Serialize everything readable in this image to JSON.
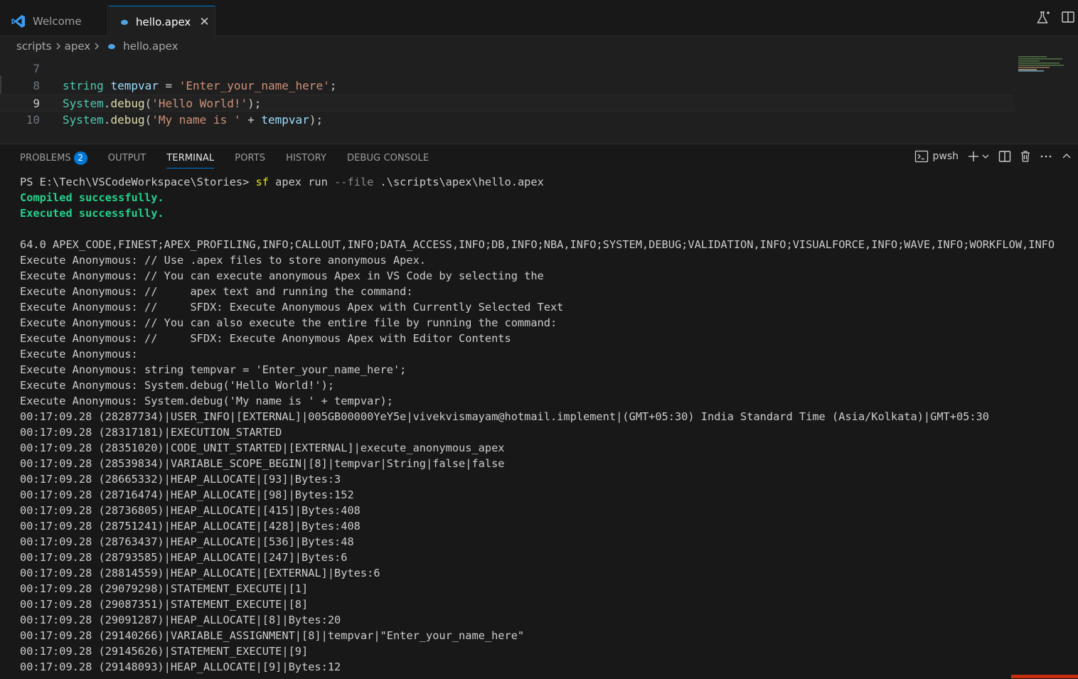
{
  "tabs": {
    "welcome": "Welcome",
    "active_file": "hello.apex",
    "close_glyph": "✕"
  },
  "breadcrumb": [
    "scripts",
    "apex",
    "hello.apex"
  ],
  "editor": {
    "lines": [
      {
        "num": "7",
        "tokens": []
      },
      {
        "num": "8",
        "tokens": [
          [
            "kw",
            "string"
          ],
          [
            "op",
            " "
          ],
          [
            "var",
            "tempvar"
          ],
          [
            "op",
            " = "
          ],
          [
            "str",
            "'Enter_your_name_here'"
          ],
          [
            "op",
            ";"
          ]
        ]
      },
      {
        "num": "9",
        "tokens": [
          [
            "kw",
            "System"
          ],
          [
            "op",
            "."
          ],
          [
            "fn",
            "debug"
          ],
          [
            "op",
            "("
          ],
          [
            "str",
            "'Hello World!'"
          ],
          [
            "op",
            ");"
          ]
        ]
      },
      {
        "num": "10",
        "tokens": [
          [
            "kw",
            "System"
          ],
          [
            "op",
            "."
          ],
          [
            "fn",
            "debug"
          ],
          [
            "op",
            "("
          ],
          [
            "str",
            "'My name is '"
          ],
          [
            "op",
            " + "
          ],
          [
            "var",
            "tempvar"
          ],
          [
            "op",
            ");"
          ]
        ]
      }
    ],
    "current_line": "9"
  },
  "panel": {
    "tabs": [
      "PROBLEMS",
      "OUTPUT",
      "TERMINAL",
      "PORTS",
      "HISTORY",
      "DEBUG CONSOLE"
    ],
    "active_tab": "TERMINAL",
    "problems_count": "2",
    "shell_name": "pwsh"
  },
  "terminal": {
    "prompt": "PS E:\\Tech\\VSCodeWorkspace\\Stories> ",
    "cmd_sf": "sf",
    "cmd_rest1": " apex run ",
    "cmd_flag": "--file",
    "cmd_rest2": " .\\scripts\\apex\\hello.apex",
    "compiled": "Compiled successfully.",
    "executed": "Executed successfully.",
    "log_lines": [
      "",
      "64.0 APEX_CODE,FINEST;APEX_PROFILING,INFO;CALLOUT,INFO;DATA_ACCESS,INFO;DB,INFO;NBA,INFO;SYSTEM,DEBUG;VALIDATION,INFO;VISUALFORCE,INFO;WAVE,INFO;WORKFLOW,INFO",
      "Execute Anonymous: // Use .apex files to store anonymous Apex.",
      "Execute Anonymous: // You can execute anonymous Apex in VS Code by selecting the",
      "Execute Anonymous: //     apex text and running the command:",
      "Execute Anonymous: //     SFDX: Execute Anonymous Apex with Currently Selected Text",
      "Execute Anonymous: // You can also execute the entire file by running the command:",
      "Execute Anonymous: //     SFDX: Execute Anonymous Apex with Editor Contents",
      "Execute Anonymous:",
      "Execute Anonymous: string tempvar = 'Enter_your_name_here';",
      "Execute Anonymous: System.debug('Hello World!');",
      "Execute Anonymous: System.debug('My name is ' + tempvar);",
      "00:17:09.28 (28287734)|USER_INFO|[EXTERNAL]|005GB00000YeY5e|vivekvismayam@hotmail.implement|(GMT+05:30) India Standard Time (Asia/Kolkata)|GMT+05:30",
      "00:17:09.28 (28317181)|EXECUTION_STARTED",
      "00:17:09.28 (28351020)|CODE_UNIT_STARTED|[EXTERNAL]|execute_anonymous_apex",
      "00:17:09.28 (28539834)|VARIABLE_SCOPE_BEGIN|[8]|tempvar|String|false|false",
      "00:17:09.28 (28665332)|HEAP_ALLOCATE|[93]|Bytes:3",
      "00:17:09.28 (28716474)|HEAP_ALLOCATE|[98]|Bytes:152",
      "00:17:09.28 (28736805)|HEAP_ALLOCATE|[415]|Bytes:408",
      "00:17:09.28 (28751241)|HEAP_ALLOCATE|[428]|Bytes:408",
      "00:17:09.28 (28763437)|HEAP_ALLOCATE|[536]|Bytes:48",
      "00:17:09.28 (28793585)|HEAP_ALLOCATE|[247]|Bytes:6",
      "00:17:09.28 (28814559)|HEAP_ALLOCATE|[EXTERNAL]|Bytes:6",
      "00:17:09.28 (29079298)|STATEMENT_EXECUTE|[1]",
      "00:17:09.28 (29087351)|STATEMENT_EXECUTE|[8]",
      "00:17:09.28 (29091287)|HEAP_ALLOCATE|[8]|Bytes:20",
      "00:17:09.28 (29140266)|VARIABLE_ASSIGNMENT|[8]|tempvar|\"Enter_your_name_here\"",
      "00:17:09.28 (29145626)|STATEMENT_EXECUTE|[9]",
      "00:17:09.28 (29148093)|HEAP_ALLOCATE|[9]|Bytes:12"
    ]
  },
  "colors": {
    "accent": "#0078d4",
    "success": "#23d18b",
    "string": "#ce9178",
    "keyword": "#4ec9b0",
    "status_error": "#c72e0f"
  }
}
